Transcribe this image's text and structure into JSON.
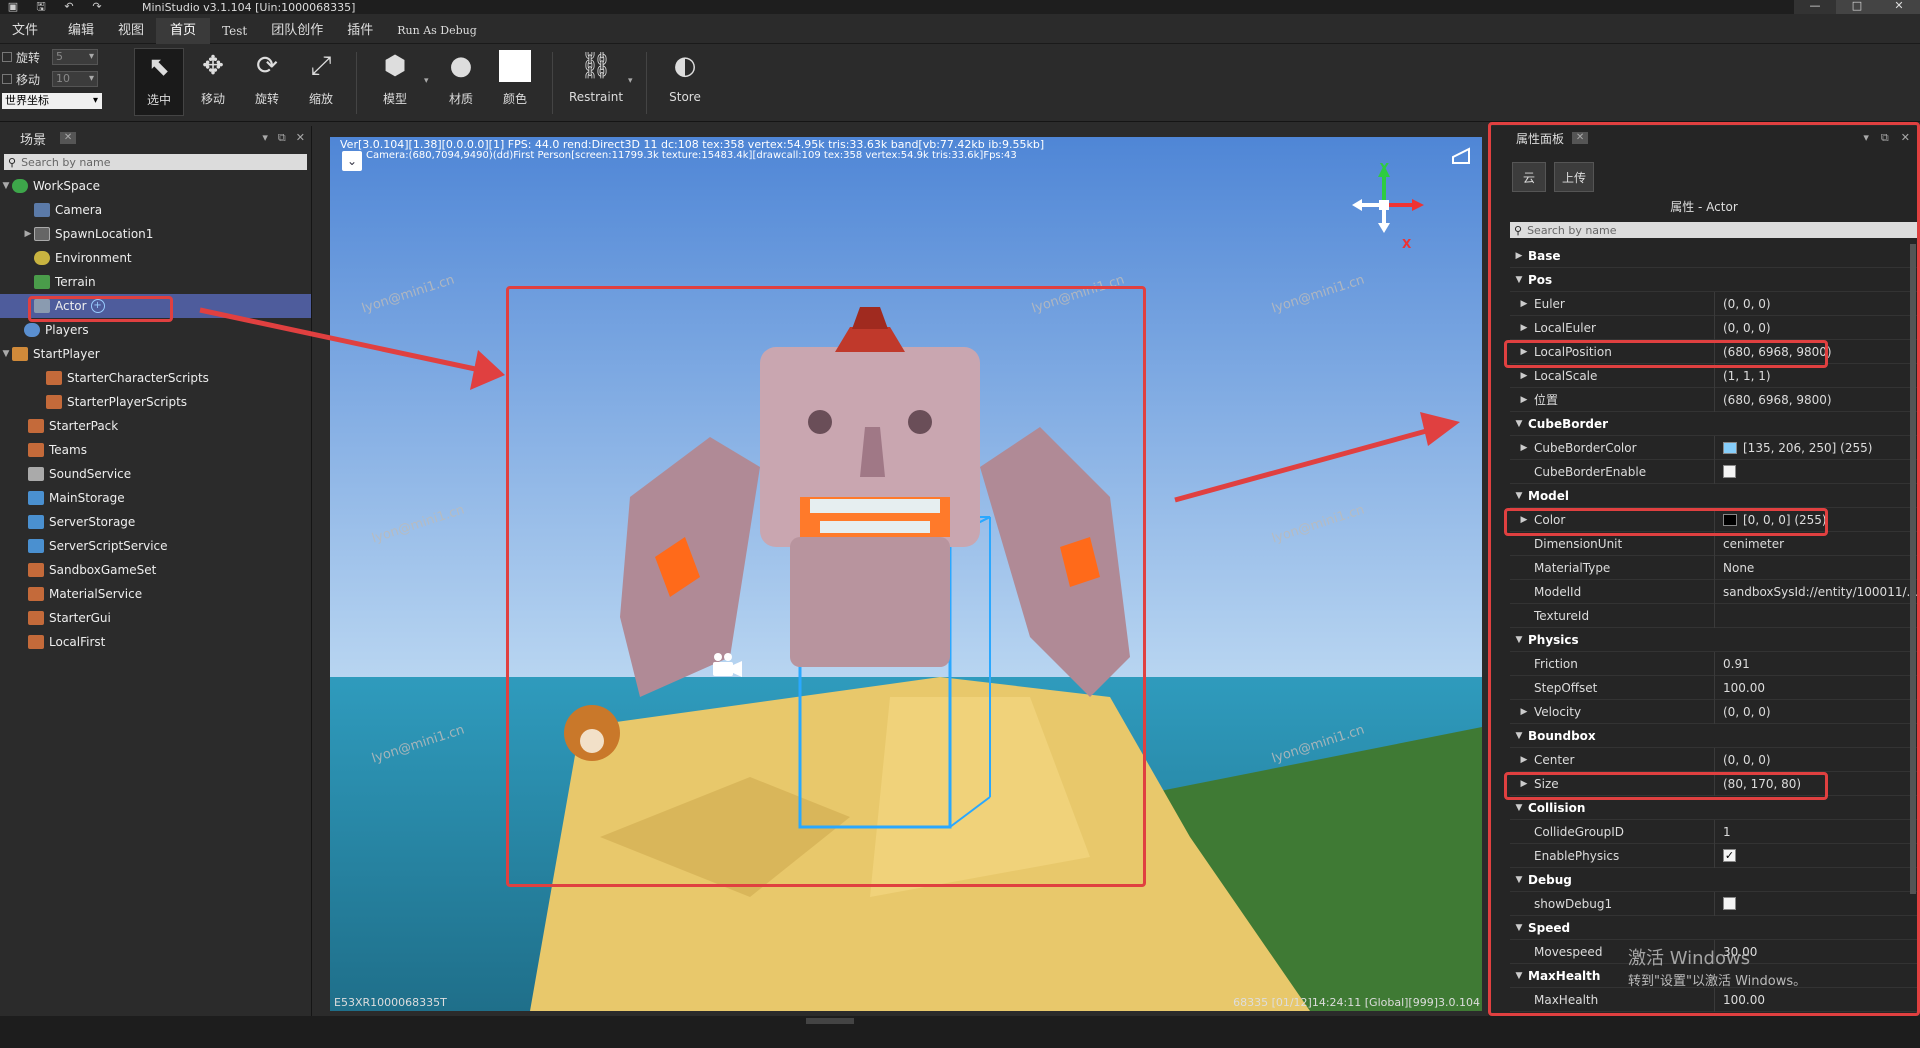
{
  "app": {
    "title": "MiniStudio v3.1.104 [Uin:1000068335]"
  },
  "menu": [
    "文件",
    "编辑",
    "视图",
    "首页",
    "Test",
    "团队创作",
    "插件",
    "Run As Debug"
  ],
  "ribbon": {
    "rotate_label": "旋转",
    "rotate_value": "5",
    "move_label": "移动",
    "move_value": "10",
    "coord_select": "世界坐标",
    "tools": {
      "select": "选中",
      "move": "移动",
      "rotate": "旋转",
      "scale": "缩放",
      "model": "模型",
      "material": "材质",
      "color": "颜色",
      "restraint": "Restraint",
      "store": "Store"
    }
  },
  "scene_panel": {
    "title": "场景",
    "search_placeholder": "Search by name",
    "items": [
      {
        "label": "WorkSpace"
      },
      {
        "label": "Camera"
      },
      {
        "label": "SpawnLocation1"
      },
      {
        "label": "Environment"
      },
      {
        "label": "Terrain"
      },
      {
        "label": "Actor"
      },
      {
        "label": "Players"
      },
      {
        "label": "StartPlayer"
      },
      {
        "label": "StarterCharacterScripts"
      },
      {
        "label": "StarterPlayerScripts"
      },
      {
        "label": "StarterPack"
      },
      {
        "label": "Teams"
      },
      {
        "label": "SoundService"
      },
      {
        "label": "MainStorage"
      },
      {
        "label": "ServerStorage"
      },
      {
        "label": "ServerScriptService"
      },
      {
        "label": "SandboxGameSet"
      },
      {
        "label": "MaterialService"
      },
      {
        "label": "StarterGui"
      },
      {
        "label": "LocalFirst"
      }
    ]
  },
  "viewport": {
    "hud_line1": "Ver[3.0.104][1.38][0.0.0.0][1] FPS: 44.0   rend:Direct3D 11 dc:108 tex:358 vertex:54.95k tris:33.63k band[vb:77.42kb ib:9.55kb]",
    "hud_line2": "Camera:(680,7094,9490)(dd)First Person[screen:11799.3k texture:15483.4k][drawcall:109 tex:358 vertex:54.9k tris:33.6k]Fps:43",
    "footer_left": "E53XR1000068335T",
    "footer_right": "68335   [01/12]14:24:11  [Global][999]3.0.104",
    "gizmo_x": "X",
    "gizmo_y": "Y",
    "watermark": "lyon@mini1.cn"
  },
  "props_panel": {
    "title": "属性面板",
    "btn_cloud": "云",
    "btn_upload": "上传",
    "header": "属性 - Actor",
    "search_placeholder": "Search by name",
    "rows": [
      {
        "type": "cat",
        "expanded": false,
        "key": "Base",
        "value": ""
      },
      {
        "type": "cat",
        "expanded": true,
        "key": "Pos",
        "value": ""
      },
      {
        "type": "prop",
        "expand": true,
        "key": "Euler",
        "value": "(0, 0, 0)"
      },
      {
        "type": "prop",
        "expand": true,
        "key": "LocalEuler",
        "value": "(0, 0, 0)"
      },
      {
        "type": "prop",
        "expand": true,
        "key": "LocalPosition",
        "value": "(680, 6968, 9800)"
      },
      {
        "type": "prop",
        "expand": true,
        "key": "LocalScale",
        "value": "(1, 1, 1)"
      },
      {
        "type": "prop",
        "expand": true,
        "key": "位置",
        "value": "(680, 6968, 9800)"
      },
      {
        "type": "cat",
        "expanded": true,
        "key": "CubeBorder",
        "value": ""
      },
      {
        "type": "prop",
        "expand": true,
        "key": "CubeBorderColor",
        "value": "[135, 206, 250] (255)",
        "swatch": "#87cefa"
      },
      {
        "type": "prop",
        "expand": false,
        "key": "CubeBorderEnable",
        "value": "",
        "check": "empty"
      },
      {
        "type": "cat",
        "expanded": true,
        "key": "Model",
        "value": ""
      },
      {
        "type": "prop",
        "expand": true,
        "key": "Color",
        "value": "[0, 0, 0] (255)",
        "swatch": "#000000"
      },
      {
        "type": "prop",
        "expand": false,
        "key": "DimensionUnit",
        "value": "cenimeter"
      },
      {
        "type": "prop",
        "expand": false,
        "key": "MaterialType",
        "value": "None"
      },
      {
        "type": "prop",
        "expand": false,
        "key": "ModelId",
        "value": "sandboxSysId://entity/100011/..."
      },
      {
        "type": "prop",
        "expand": false,
        "key": "TextureId",
        "value": ""
      },
      {
        "type": "cat",
        "expanded": true,
        "key": "Physics",
        "value": ""
      },
      {
        "type": "prop",
        "expand": false,
        "key": "Friction",
        "value": "0.91"
      },
      {
        "type": "prop",
        "expand": false,
        "key": "StepOffset",
        "value": "100.00"
      },
      {
        "type": "prop",
        "expand": true,
        "key": "Velocity",
        "value": "(0, 0, 0)"
      },
      {
        "type": "cat",
        "expanded": true,
        "key": "Boundbox",
        "value": ""
      },
      {
        "type": "prop",
        "expand": true,
        "key": "Center",
        "value": "(0, 0, 0)"
      },
      {
        "type": "prop",
        "expand": true,
        "key": "Size",
        "value": "(80, 170, 80)"
      },
      {
        "type": "cat",
        "expanded": true,
        "key": "Collision",
        "value": ""
      },
      {
        "type": "prop",
        "expand": false,
        "key": "CollideGroupID",
        "value": "1"
      },
      {
        "type": "prop",
        "expand": false,
        "key": "EnablePhysics",
        "value": "",
        "check": "checked"
      },
      {
        "type": "cat",
        "expanded": true,
        "key": "Debug",
        "value": ""
      },
      {
        "type": "prop",
        "expand": false,
        "key": "showDebug1",
        "value": "",
        "check": "empty"
      },
      {
        "type": "cat",
        "expanded": true,
        "key": "Speed",
        "value": ""
      },
      {
        "type": "prop",
        "expand": false,
        "key": "Movespeed",
        "value": "30.00"
      },
      {
        "type": "cat",
        "expanded": true,
        "key": "MaxHealth",
        "value": ""
      },
      {
        "type": "prop",
        "expand": false,
        "key": "MaxHealth",
        "value": "100.00"
      }
    ]
  },
  "activation": {
    "line1": "激活 Windows",
    "line2": "转到\"设置\"以激活 Windows。"
  },
  "colors": {
    "highlight": "#4e5c9c",
    "annotation_red": "#e04040",
    "selection_box": "#2aa8ff"
  }
}
